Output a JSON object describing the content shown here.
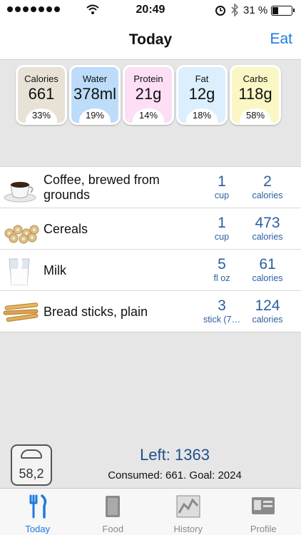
{
  "status_bar": {
    "time": "20:49",
    "battery_percent": "31 %",
    "battery_level": 0.31
  },
  "nav": {
    "title": "Today",
    "action": "Eat"
  },
  "nutrients": [
    {
      "label": "Calories",
      "value": "661",
      "percent": "33%",
      "color": "#e8e2d6"
    },
    {
      "label": "Water",
      "value": "378ml",
      "percent": "19%",
      "color": "#bcdcf9"
    },
    {
      "label": "Protein",
      "value": "21g",
      "percent": "14%",
      "color": "#fcdff4"
    },
    {
      "label": "Fat",
      "value": "12g",
      "percent": "18%",
      "color": "#dcefff"
    },
    {
      "label": "Carbs",
      "value": "118g",
      "percent": "58%",
      "color": "#fbf7c5"
    }
  ],
  "foods": [
    {
      "name": "Coffee, brewed from grounds",
      "qty": "1",
      "unit": "cup",
      "calories": "2",
      "cal_label": "calories",
      "icon": "coffee-cup-icon"
    },
    {
      "name": "Cereals",
      "qty": "1",
      "unit": "cup",
      "calories": "473",
      "cal_label": "calories",
      "icon": "cereal-icon"
    },
    {
      "name": "Milk",
      "qty": "5",
      "unit": "fl oz",
      "calories": "61",
      "cal_label": "calories",
      "icon": "milk-icon"
    },
    {
      "name": "Bread sticks, plain",
      "qty": "3",
      "unit": "stick (7…",
      "calories": "124",
      "cal_label": "calories",
      "icon": "bread-sticks-icon"
    }
  ],
  "summary": {
    "weight": "58,2",
    "left": "Left: 1363",
    "consumed": "Consumed: 661.  Goal: 2024"
  },
  "tabs": [
    {
      "label": "Today",
      "icon": "fork-knife-icon",
      "active": true
    },
    {
      "label": "Food",
      "icon": "book-icon",
      "active": false
    },
    {
      "label": "History",
      "icon": "chart-icon",
      "active": false
    },
    {
      "label": "Profile",
      "icon": "profile-card-icon",
      "active": false
    }
  ],
  "colors": {
    "accent": "#1f7ae0",
    "value_blue": "#2a5fa0"
  }
}
